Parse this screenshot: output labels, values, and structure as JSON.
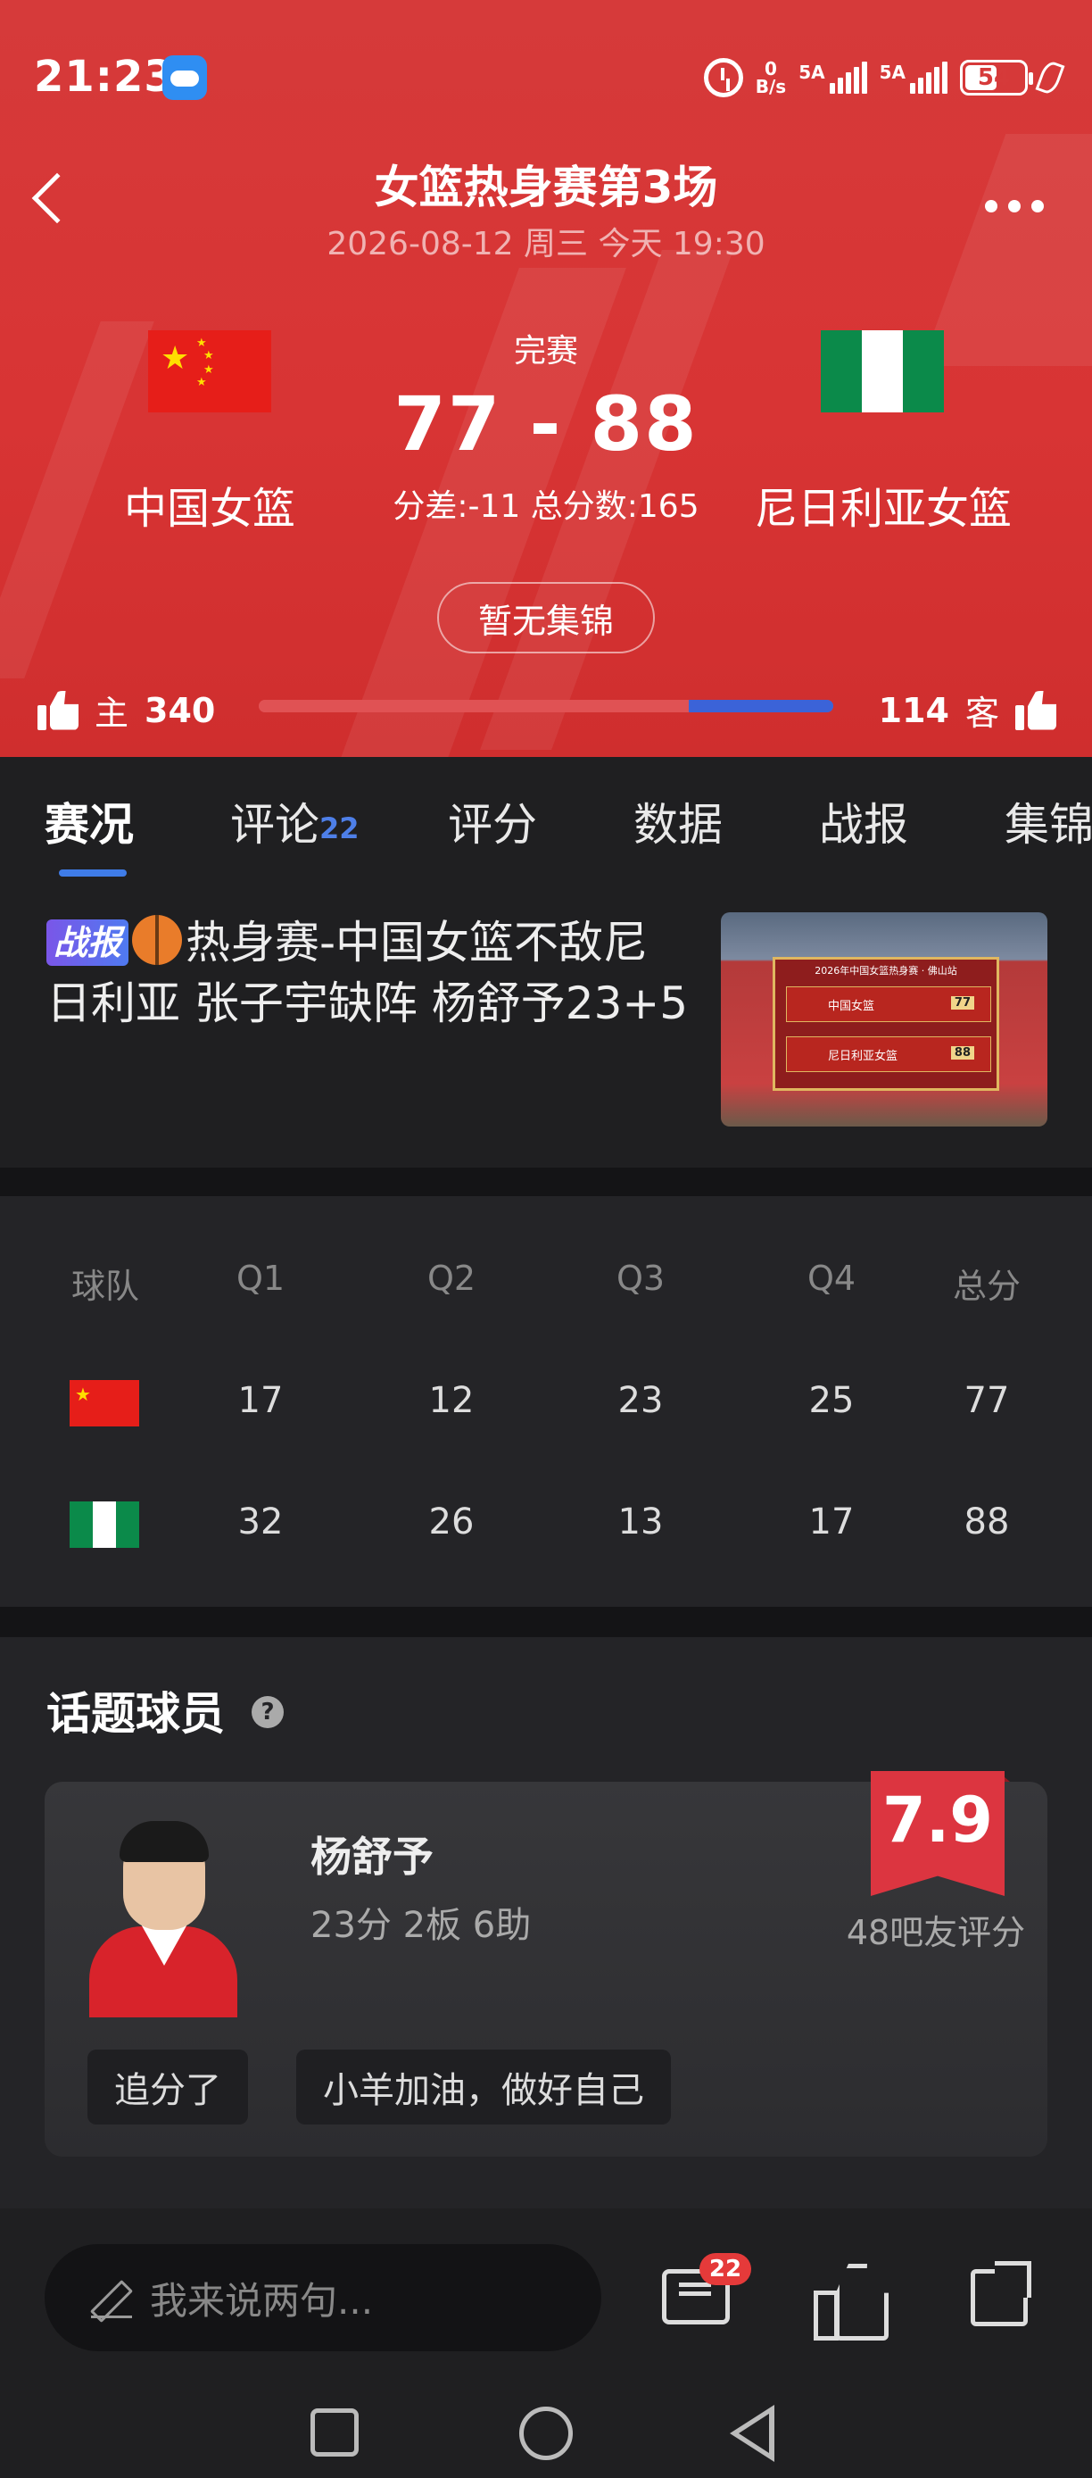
{
  "status_bar": {
    "time": "21:23",
    "net_speed_value": "0",
    "net_speed_unit": "B/s",
    "signal1_label": "5A",
    "signal2_label": "5A",
    "battery": "54",
    "battery_level_percent": 54
  },
  "header": {
    "title": "女篮热身赛第3场",
    "subtitle": "2026-08-12 周三 今天 19:30",
    "status": "完赛",
    "score": "77 - 88",
    "home_team": "中国女篮",
    "away_team": "尼日利亚女篮",
    "summary": "分差:-11 总分数:165",
    "highlight_button": "暂无集锦",
    "home_vote_label": "主",
    "home_votes": "340",
    "away_vote_label": "客",
    "away_votes": "114",
    "vote_home_fraction": 0.749,
    "colors": {
      "header_bg": "#d63a3a",
      "home_bar": "#e05254",
      "away_bar": "#3b63d8"
    }
  },
  "tabs": [
    {
      "label": "赛况",
      "active": true
    },
    {
      "label": "评论",
      "badge": "22"
    },
    {
      "label": "评分"
    },
    {
      "label": "数据"
    },
    {
      "label": "战报"
    },
    {
      "label": "集锦"
    }
  ],
  "news": {
    "badge": "战报",
    "icon": "basketball-icon",
    "headline": "热身赛-中国女篮不敌尼日利亚 张子宇缺阵 杨舒予23+5",
    "thumbnail": {
      "board_title": "2026年中国女篮热身赛 · 佛山站",
      "home_team": "中国女篮",
      "home_score": "77",
      "away_team": "尼日利亚女篮",
      "away_score": "88"
    }
  },
  "score_table": {
    "headers": [
      "球队",
      "Q1",
      "Q2",
      "Q3",
      "Q4",
      "总分"
    ],
    "rows": [
      {
        "team_flag": "china-flag",
        "scores": [
          "17",
          "12",
          "23",
          "25",
          "77"
        ]
      },
      {
        "team_flag": "nigeria-flag",
        "scores": [
          "32",
          "26",
          "13",
          "17",
          "88"
        ]
      }
    ]
  },
  "hot_player": {
    "section_title": "话题球员",
    "help_icon": "?",
    "name": "杨舒予",
    "stats": "23分 2板 6助",
    "rating": "7.9",
    "rating_label": "48吧友评分",
    "chips": [
      "追分了",
      "小羊加油，做好自己"
    ]
  },
  "bottom_bar": {
    "comment_placeholder": "我来说两句...",
    "comment_count": "22"
  }
}
